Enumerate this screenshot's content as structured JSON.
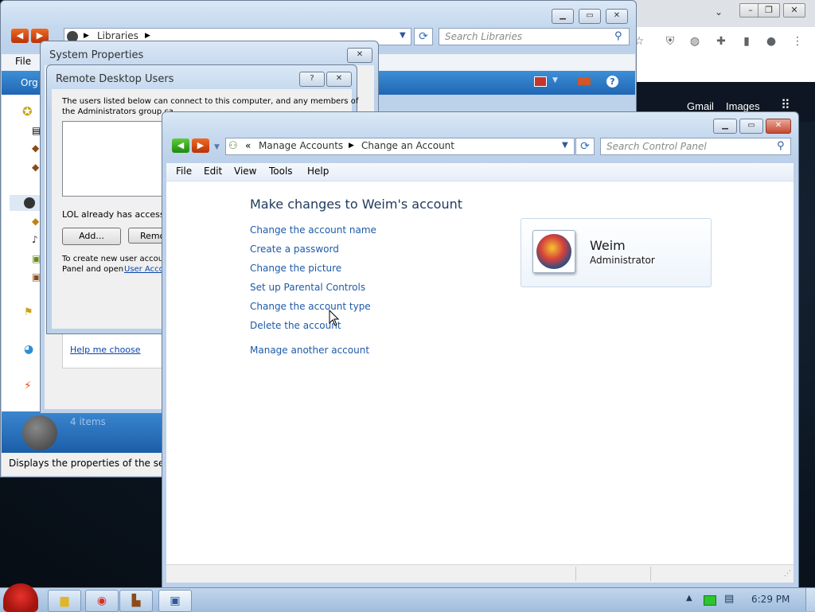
{
  "browser": {
    "links": {
      "gmail": "Gmail",
      "images": "Images"
    },
    "window_controls": {
      "minimize": "⌄",
      "restore": "❐",
      "close": "✕"
    }
  },
  "libraries_window": {
    "address": "Libraries",
    "search_placeholder": "Search Libraries",
    "menu_file": "File",
    "organize": "Org",
    "items_count": "4 items",
    "status": "Displays the properties of the sel"
  },
  "system_properties": {
    "title": "System Properties",
    "help_link": "Help me choose"
  },
  "remote_desktop_users": {
    "title": "Remote Desktop Users",
    "description_1": "The users listed below can connect to this computer, and any members of",
    "description_2": "the Administrators group ca",
    "access_note": "LOL already has access.",
    "add_button": "Add...",
    "remove_button": "Remo",
    "create_note_1": "To create new user accoun",
    "create_note_2": "Panel and open",
    "user_accounts_link": "User Acco"
  },
  "control_panel": {
    "breadcrumb_overflow": "«",
    "breadcrumb_1": "Manage Accounts",
    "breadcrumb_2": "Change an Account",
    "search_placeholder": "Search Control Panel",
    "menu": {
      "file": "File",
      "edit": "Edit",
      "view": "View",
      "tools": "Tools",
      "help": "Help"
    },
    "heading": "Make changes to Weim's account",
    "links": [
      "Change the account name",
      "Create a password",
      "Change the picture",
      "Set up Parental Controls",
      "Change the account type",
      "Delete the account"
    ],
    "manage_another": "Manage another account",
    "account": {
      "name": "Weim",
      "type": "Administrator"
    }
  },
  "taskbar": {
    "time": "6:29 PM"
  },
  "colors": {
    "link_blue": "#1e5aa8",
    "heading_blue": "#1e395b",
    "taskbar": "#b4cbe6"
  }
}
